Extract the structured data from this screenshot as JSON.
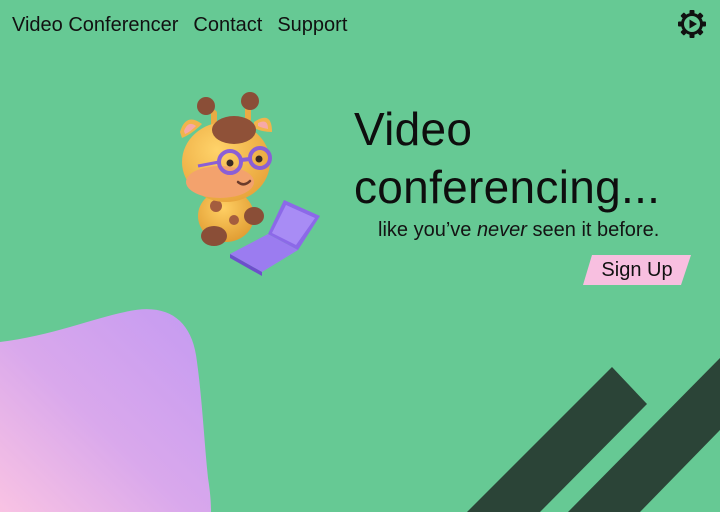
{
  "nav": {
    "brand": "Video Conferencer",
    "links": [
      {
        "label": "Contact"
      },
      {
        "label": "Support"
      }
    ],
    "settings_icon": "gear-icon"
  },
  "hero": {
    "title_line1": "Video",
    "title_line2": "conferencing...",
    "tagline_before": "like you’ve ",
    "tagline_emphasis": "never",
    "tagline_after": " seen it before.",
    "signup_label": "Sign Up",
    "illustration_icon": "giraffe-with-laptop-illustration"
  },
  "colors": {
    "background": "#66c994",
    "signup_button": "#f8bfe0",
    "stripes": "#2b4437",
    "blob_start": "#c79af0",
    "blob_end": "#f8c2e4"
  }
}
